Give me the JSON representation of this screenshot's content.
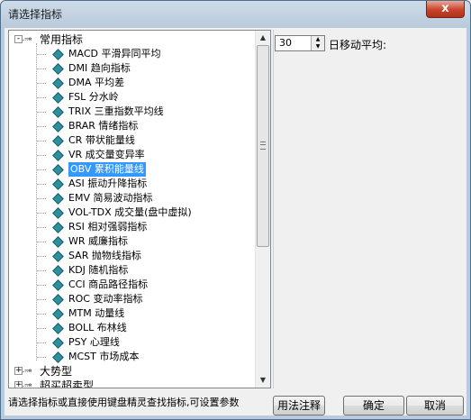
{
  "window": {
    "title": "请选择指标",
    "close_glyph": "x"
  },
  "tree": {
    "groups": [
      {
        "label": "常用指标",
        "expander": "-",
        "items": [
          "MACD 平滑异同平均",
          "DMI 趋向指标",
          "DMA 平均差",
          "FSL 分水岭",
          "TRIX 三重指数平均线",
          "BRAR 情绪指标",
          "CR 带状能量线",
          "VR 成交量变异率",
          "OBV 累积能量线",
          "ASI 振动升降指标",
          "EMV 简易波动指标",
          "VOL-TDX 成交量(盘中虚拟)",
          "RSI 相对强弱指标",
          "WR 威廉指标",
          "SAR 抛物线指标",
          "KDJ 随机指标",
          "CCI 商品路径指标",
          "ROC 变动率指标",
          "MTM 动量线",
          "BOLL 布林线",
          "PSY 心理线",
          "MCST 市场成本"
        ],
        "selected_index": 8
      },
      {
        "label": "大势型",
        "expander": "+"
      },
      {
        "label": "超买超卖型",
        "expander": "+"
      }
    ]
  },
  "param": {
    "value": "30",
    "label": "日移动平均:"
  },
  "status": {
    "text": "请选择指标或直接使用键盘精灵查找指标,可设置参数"
  },
  "buttons": {
    "usage": "用法注释",
    "ok": "确定",
    "cancel": "取消"
  },
  "icons": {
    "group": "key-icon",
    "leaf": "diamond-indicator-icon"
  }
}
